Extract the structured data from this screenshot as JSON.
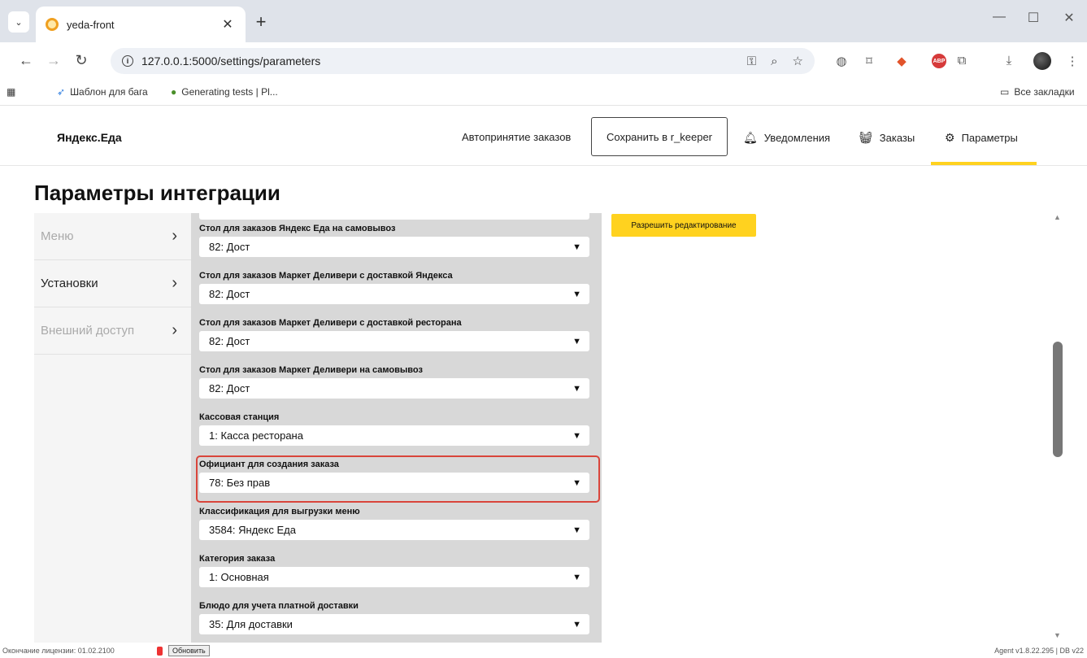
{
  "browser": {
    "tab_title": "yeda-front",
    "url": "127.0.0.1:5000/settings/parameters",
    "bookmarks": [
      "Шаблон для бага",
      "Generating tests | Pl..."
    ],
    "all_bookmarks": "Все закладки"
  },
  "app": {
    "logo": "Яндекс.Еда",
    "nav": {
      "auto_accept": "Автопринятие заказов",
      "save": "Сохранить в r_keeper",
      "notifications": "Уведомления",
      "orders": "Заказы",
      "params": "Параметры"
    },
    "page_title": "Параметры интеграции",
    "sidebar": [
      {
        "label": "Меню",
        "muted": true
      },
      {
        "label": "Установки",
        "muted": false
      },
      {
        "label": "Внешний доступ",
        "muted": true
      }
    ],
    "fields": [
      {
        "label": "Стол для заказов Яндекс Еда на самовывоз",
        "value": "82: Дост"
      },
      {
        "label": "Стол для заказов Маркет Деливери с доставкой Яндекса",
        "value": "82: Дост"
      },
      {
        "label": "Стол для заказов Маркет Деливери с доставкой ресторана",
        "value": "82: Дост"
      },
      {
        "label": "Стол для заказов Маркет Деливери на самовывоз",
        "value": "82: Дост"
      },
      {
        "label": "Кассовая станция",
        "value": "1: Касса ресторана"
      },
      {
        "label": "Официант для создания заказа",
        "value": "78: Без прав"
      },
      {
        "label": "Классификация для выгрузки меню",
        "value": "3584: Яндекс Еда"
      },
      {
        "label": "Категория заказа",
        "value": "1: Основная"
      },
      {
        "label": "Блюдо для учета платной доставки",
        "value": "35: Для доставки"
      }
    ],
    "edit_button": "Разрешить редактирование",
    "status": {
      "license": "Окончание лицензии: 01.02.2100",
      "refresh": "Обновить",
      "agent": "Agent v1.8.22.295  |  DB v22"
    }
  }
}
